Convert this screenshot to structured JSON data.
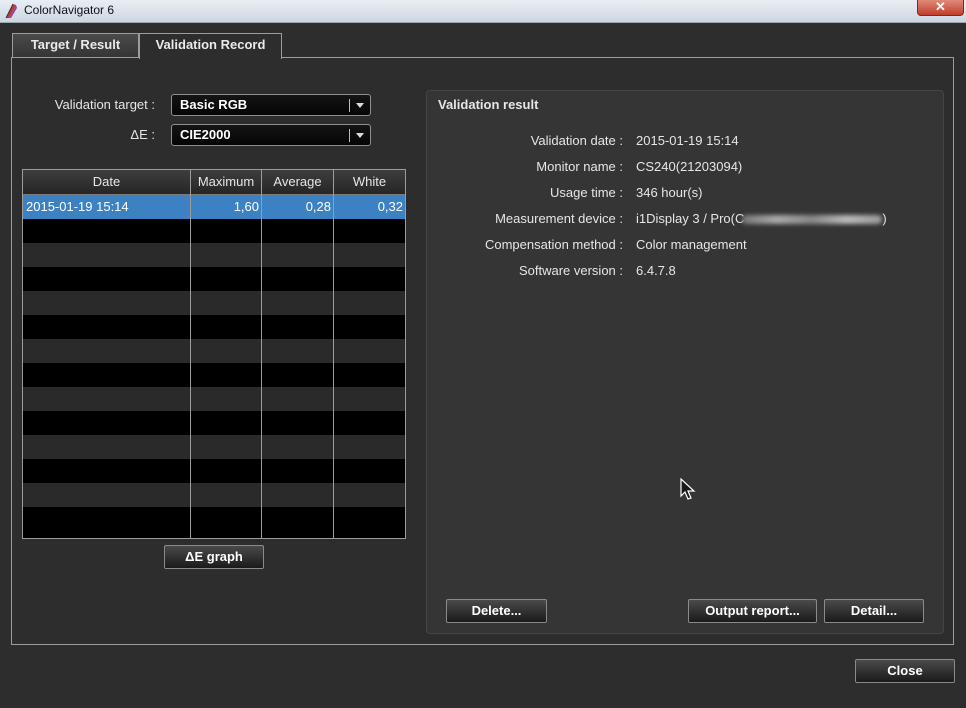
{
  "window": {
    "title": "ColorNavigator 6",
    "close_glyph": "✕"
  },
  "tabs": [
    {
      "label": "Target / Result",
      "active": false
    },
    {
      "label": "Validation Record",
      "active": true
    }
  ],
  "filters": {
    "target_label": "Validation target :",
    "target_value": "Basic RGB",
    "de_label": "ΔE :",
    "de_value": "CIE2000"
  },
  "table": {
    "columns": [
      "Date",
      "Maximum",
      "Average",
      "White"
    ],
    "rows": [
      {
        "date": "2015-01-19 15:14",
        "max": "1,60",
        "avg": "0,28",
        "white": "0,32",
        "selected": true
      }
    ]
  },
  "de_graph_button": "ΔE graph",
  "result": {
    "title": "Validation result",
    "fields": [
      {
        "label": "Validation date :",
        "value": "2015-01-19 15:14"
      },
      {
        "label": "Monitor name :",
        "value": "CS240(21203094)"
      },
      {
        "label": "Usage time :",
        "value": "346 hour(s)"
      },
      {
        "label": "Measurement device :",
        "value": "i1Display 3 / Pro(C",
        "suffix": ")"
      },
      {
        "label": "Compensation method :",
        "value": "Color management"
      },
      {
        "label": "Software version :",
        "value": "6.4.7.8"
      }
    ],
    "delete_button": "Delete...",
    "output_report_button": "Output report...",
    "detail_button": "Detail..."
  },
  "close_button": "Close",
  "colors": {
    "selection": "#3c82c2",
    "background": "#2d2d2d"
  },
  "icons": {
    "app": "colornavigator-app-icon",
    "cursor": "mouse-pointer-icon",
    "dropdown": "chevron-down-icon"
  }
}
